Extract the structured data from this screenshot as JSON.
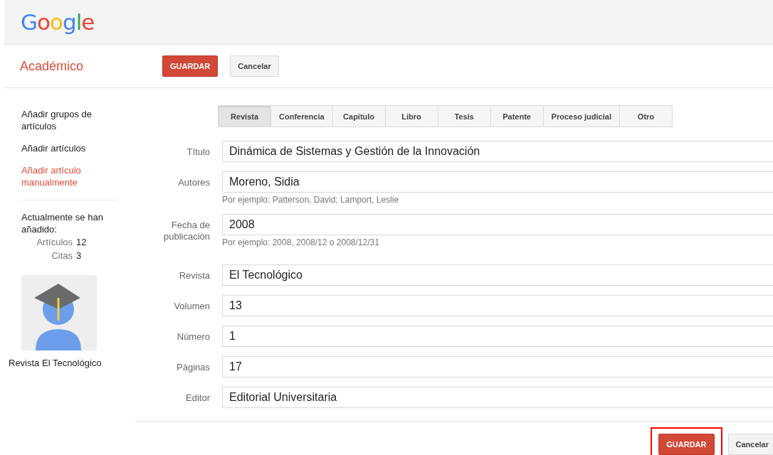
{
  "header": {
    "logo": "Google"
  },
  "toolbar": {
    "title": "Académico",
    "buttons": [
      {
        "label": "GUARDAR",
        "kind": "primary",
        "highlighted": false
      },
      {
        "label": "Cancelar",
        "kind": "secondary",
        "highlighted": false
      }
    ]
  },
  "sidebar": {
    "items": [
      {
        "label": "Añadir grupos de artículos",
        "selected": false
      },
      {
        "label": "Añadir artículos",
        "selected": false
      },
      {
        "label": "Añadir artículo manualmente",
        "selected": true
      }
    ],
    "summary_title": "Actualmente se han añadido:",
    "stats": [
      {
        "label": "Artículos",
        "value": "12"
      },
      {
        "label": "Citas",
        "value": "3"
      }
    ],
    "profile": {
      "name": "Revista El Tecnológico"
    }
  },
  "tabs": [
    {
      "label": "Revista",
      "selected": true
    },
    {
      "label": "Conferencia",
      "selected": false
    },
    {
      "label": "Capítulo",
      "selected": false
    },
    {
      "label": "Libro",
      "selected": false
    },
    {
      "label": "Tesis",
      "selected": false
    },
    {
      "label": "Patente",
      "selected": false
    },
    {
      "label": "Proceso judicial",
      "selected": false
    },
    {
      "label": "Otro",
      "selected": false
    }
  ],
  "sections": [
    {
      "fields": [
        {
          "label": "Título",
          "value": "Dinámica de Sistemas y Gestión de la Innovación"
        },
        {
          "label": "Autores",
          "value": "Moreno, Sidia",
          "hint": "Por ejemplo: Patterson, David; Lamport, Leslie"
        },
        {
          "label": "Fecha de publicación",
          "value": "2008",
          "hint": "Por ejemplo: 2008, 2008/12 o 2008/12/31"
        }
      ]
    },
    {
      "fields": [
        {
          "label": "Revista",
          "value": "El Tecnológico"
        },
        {
          "label": "Volumen",
          "value": "13"
        },
        {
          "label": "Número",
          "value": "1"
        },
        {
          "label": "Páginas",
          "value": "17"
        },
        {
          "label": "Editor",
          "value": "Editorial Universitaria"
        }
      ]
    }
  ],
  "footer_buttons": [
    {
      "label": "GUARDAR",
      "kind": "primary",
      "highlighted": true
    },
    {
      "label": "Cancelar",
      "kind": "secondary",
      "highlighted": false
    }
  ]
}
